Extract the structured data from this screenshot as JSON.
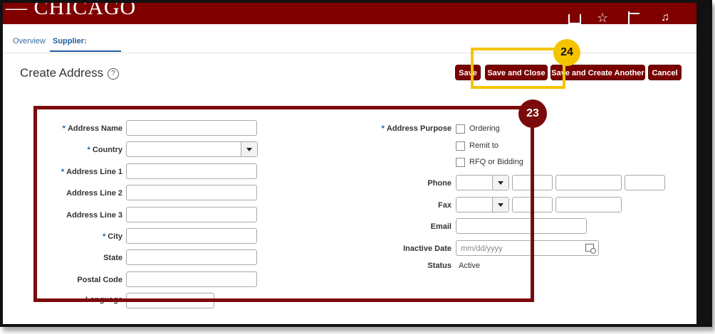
{
  "header": {
    "logo_text": "— CHICAGO"
  },
  "tabs": {
    "overview": "Overview",
    "supplier": "Supplier:"
  },
  "page": {
    "title": "Create Address",
    "help": "?"
  },
  "toolbar": {
    "save": "Save",
    "save_and_close": "Save and Close",
    "save_and_create_another": "Save and Create Another",
    "cancel": "Cancel"
  },
  "callouts": {
    "step24": "24",
    "step23": "23"
  },
  "form": {
    "required_marker": "*",
    "left": {
      "address_name": "Address Name",
      "country": "Country",
      "address_line_1": "Address Line 1",
      "address_line_2": "Address Line 2",
      "address_line_3": "Address Line 3",
      "city": "City",
      "state": "State",
      "postal_code": "Postal Code",
      "language": "Language"
    },
    "right": {
      "address_purpose": "Address Purpose",
      "purposes": [
        "Ordering",
        "Remit to",
        "RFQ or Bidding"
      ],
      "phone": "Phone",
      "fax": "Fax",
      "email": "Email",
      "inactive_date": "Inactive Date",
      "inactive_date_placeholder": "mm/dd/yyyy",
      "status": "Status",
      "status_value": "Active"
    }
  }
}
